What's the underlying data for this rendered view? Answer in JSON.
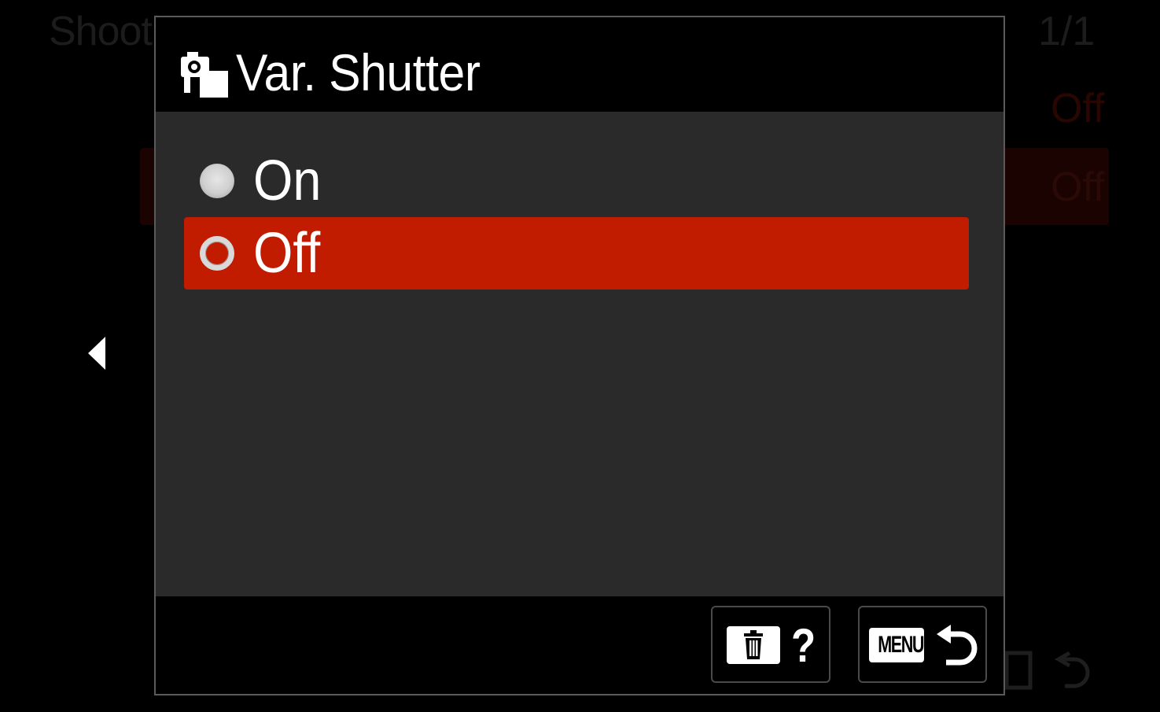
{
  "background": {
    "title": "Shooti",
    "page_indicator": "1/1",
    "row1_value": "Off",
    "row2_value": "Off"
  },
  "dialog": {
    "title": "Var. Shutter",
    "header_icon": "camera-settings-icon",
    "options": [
      {
        "label": "On",
        "selected": false
      },
      {
        "label": "Off",
        "selected": true
      }
    ],
    "footer": {
      "help_symbol": "?",
      "menu_label": "MENU"
    }
  },
  "colors": {
    "selection": "#c21c00",
    "panel": "#2a2a2a",
    "background": "#000000"
  }
}
